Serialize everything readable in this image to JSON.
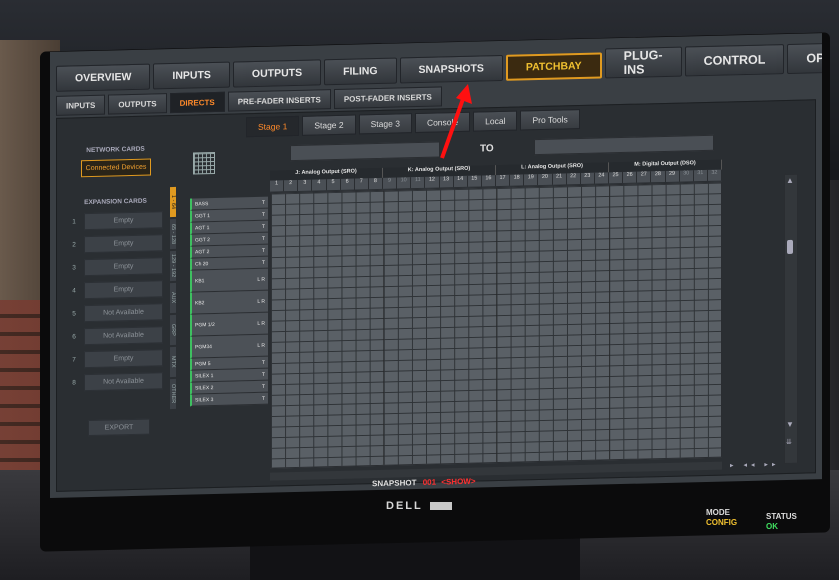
{
  "top_tabs": [
    {
      "label": "OVERVIEW"
    },
    {
      "label": "INPUTS"
    },
    {
      "label": "OUTPUTS"
    },
    {
      "label": "FILING"
    },
    {
      "label": "SNAPSHOTS"
    },
    {
      "label": "PATCHBAY",
      "active": true
    },
    {
      "label": "PLUG-INS"
    },
    {
      "label": "CONTROL"
    },
    {
      "label": "OPTIONS"
    }
  ],
  "sub_tabs": [
    {
      "label": "INPUTS"
    },
    {
      "label": "OUTPUTS"
    },
    {
      "label": "DIRECTS",
      "active": true
    },
    {
      "label": "PRE-FADER INSERTS"
    },
    {
      "label": "POST-FADER INSERTS"
    }
  ],
  "stage_tabs": [
    {
      "label": "Stage 1",
      "active": true
    },
    {
      "label": "Stage 2"
    },
    {
      "label": "Stage 3"
    },
    {
      "label": "Console"
    },
    {
      "label": "Local"
    },
    {
      "label": "Pro Tools"
    }
  ],
  "network_cards_label": "NETWORK CARDS",
  "connected_devices": "Connected Devices",
  "expansion_cards_label": "EXPANSION CARDS",
  "expansion_slots": [
    {
      "num": "1",
      "value": "Empty"
    },
    {
      "num": "2",
      "value": "Empty"
    },
    {
      "num": "3",
      "value": "Empty"
    },
    {
      "num": "4",
      "value": "Empty"
    },
    {
      "num": "5",
      "value": "Not Available"
    },
    {
      "num": "6",
      "value": "Not Available"
    },
    {
      "num": "7",
      "value": "Empty"
    },
    {
      "num": "8",
      "value": "Not Available"
    }
  ],
  "export_label": "EXPORT",
  "vertical_tabs": [
    "1 - 64",
    "65 - 128",
    "129 - 192",
    "AUX",
    "GRP",
    "MTX",
    "OTHER"
  ],
  "to_label": "TO",
  "output_headers": [
    "J: Analog Output (SRO)",
    "K: Analog Output (SRO)",
    "L: Analog Output (SRO)",
    "M: Digital Output (DSO)"
  ],
  "output_numbers": [
    "1",
    "2",
    "3",
    "4",
    "5",
    "6",
    "7",
    "8",
    "9",
    "10",
    "11",
    "12",
    "13",
    "14",
    "15",
    "16",
    "17",
    "18",
    "19",
    "20",
    "21",
    "22",
    "23",
    "24",
    "25",
    "26",
    "27",
    "28",
    "29",
    "30",
    "31",
    "32"
  ],
  "channels": [
    {
      "name": "BASS",
      "flag": "T"
    },
    {
      "name": "GGT 1",
      "flag": "T"
    },
    {
      "name": "AGT 1",
      "flag": "T"
    },
    {
      "name": "GGT 2",
      "flag": "T"
    },
    {
      "name": "AGT 2",
      "flag": "T"
    },
    {
      "name": "Ch 20",
      "flag": "T"
    },
    {
      "name": "KB1",
      "flag": "L R",
      "tall": true
    },
    {
      "name": "KB2",
      "flag": "L R",
      "tall": true
    },
    {
      "name": "PGM 1/2",
      "flag": "L R",
      "tall": true
    },
    {
      "name": "PGM34",
      "flag": "L R",
      "tall": true
    },
    {
      "name": "PGM 5",
      "flag": "T"
    },
    {
      "name": "SILEX 1",
      "flag": "T"
    },
    {
      "name": "SILEX 2",
      "flag": "T"
    },
    {
      "name": "SILEX 3",
      "flag": "T"
    }
  ],
  "snapshot_label": "SNAPSHOT",
  "snapshot_number": "001",
  "snapshot_name": "<SHOW>",
  "brand": "DELL",
  "mode_label": "MODE",
  "mode_value": "CONFIG",
  "status_label": "STATUS",
  "status_value": "OK",
  "colors": {
    "accent": "#e09a20",
    "active_text": "#ff8a2a",
    "ok": "#40e060",
    "snapshot": "#ff3030"
  }
}
